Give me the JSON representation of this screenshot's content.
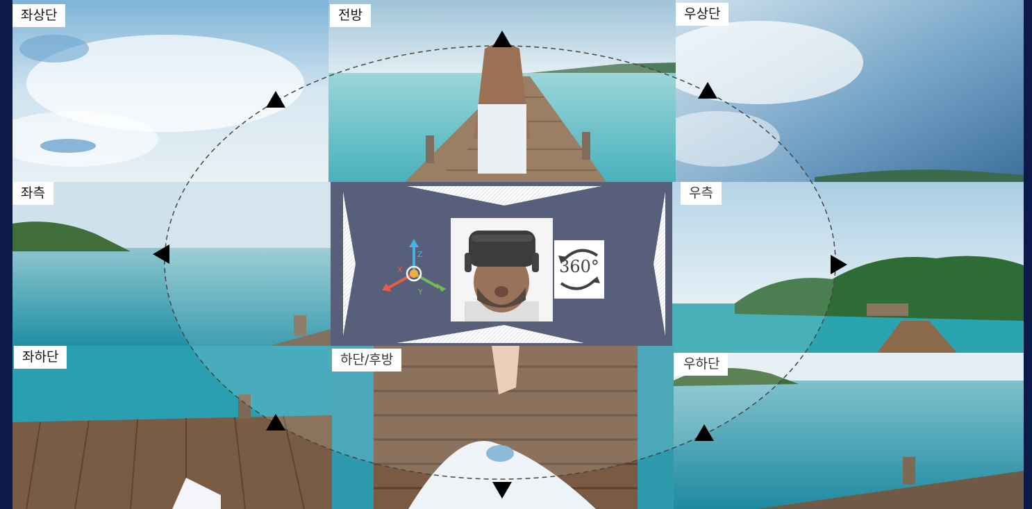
{
  "tiles": {
    "top_left": "좌상단",
    "top_center": "전방",
    "top_right": "우상단",
    "middle_left": "좌측",
    "middle_right": "우측",
    "bottom_left": "좌하단",
    "bottom_center": "하단/후방",
    "bottom_right": "우하단"
  },
  "center": {
    "rotation_label": "360°",
    "axis_x": "X",
    "axis_y": "Y",
    "axis_z": "Z"
  },
  "colors": {
    "background": "#0b1a4a",
    "center_panel": "#3c4565",
    "axis_x": "#e0452a",
    "axis_y": "#5fb03a",
    "axis_z": "#2ea3e0",
    "origin": "#f0a020"
  },
  "icons": [
    "vr-headset-person-icon",
    "rotate-360-icon",
    "xyz-axis-icon",
    "direction-arrow-icon"
  ]
}
